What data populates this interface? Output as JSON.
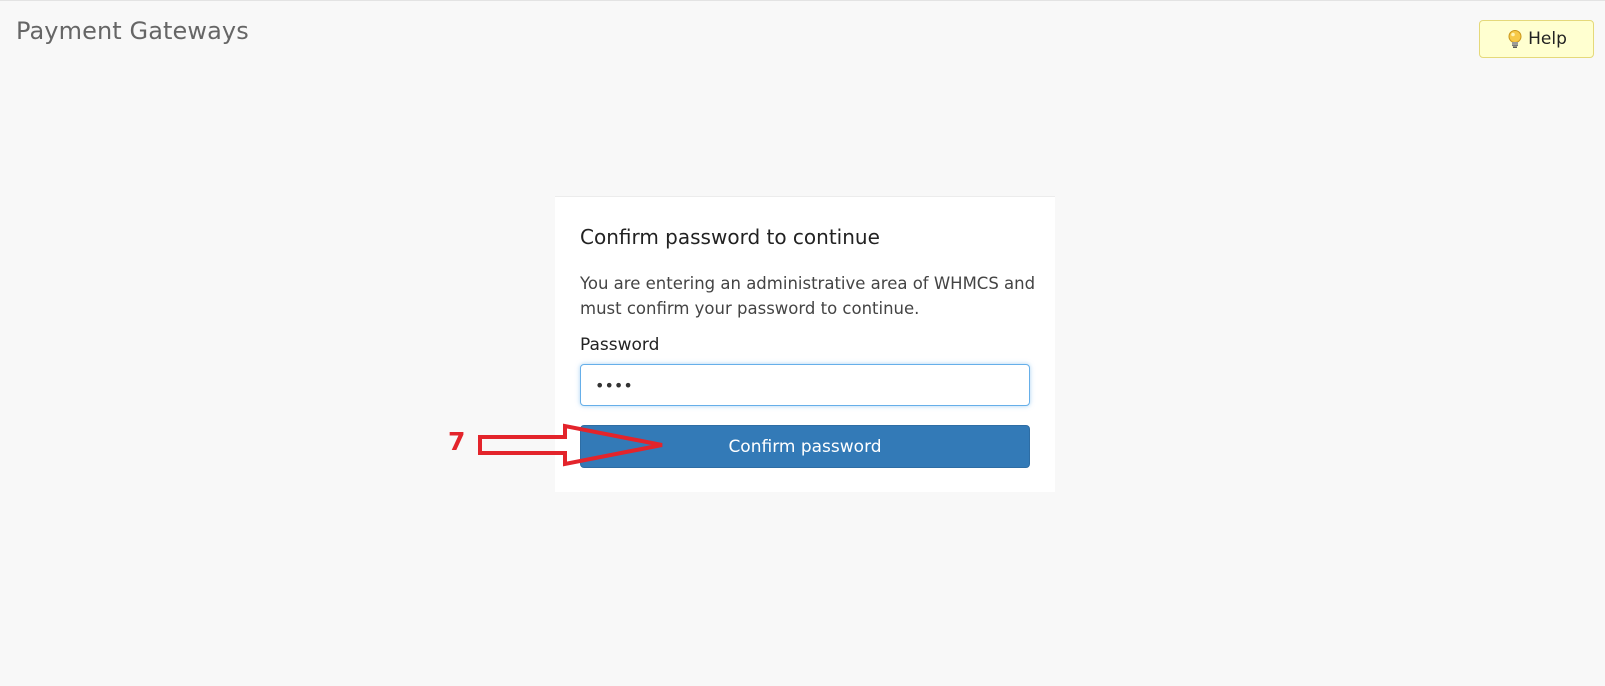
{
  "page": {
    "title": "Payment Gateways"
  },
  "header": {
    "help_label": "Help"
  },
  "dialog": {
    "title": "Confirm password to continue",
    "description": "You are entering an administrative area of WHMCS and must confirm your password to continue.",
    "password_label": "Password",
    "password_value": "••••",
    "confirm_label": "Confirm password"
  },
  "annotation": {
    "step_number": "7"
  },
  "colors": {
    "primary": "#337ab7",
    "annotation": "#e3242b",
    "help_bg": "#ffffd0"
  }
}
